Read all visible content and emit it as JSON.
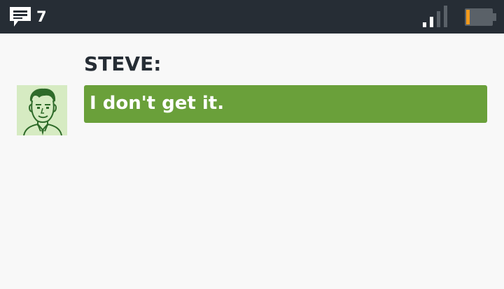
{
  "status_bar": {
    "message_icon": "message-icon",
    "message_count": "7",
    "signal_icon": "signal-icon",
    "battery_icon": "battery-icon",
    "signal_bars_active": 2,
    "signal_bars_total": 4,
    "battery_level": 0.15,
    "colors": {
      "background": "#262d35",
      "signal_active": "#ffffff",
      "signal_inactive": "#5a6168",
      "battery_body": "#5a6168",
      "battery_charge": "#f29a1c"
    }
  },
  "dialogue": {
    "speaker": "STEVE:",
    "avatar_icon": "steve-portrait-icon",
    "text": "I don't get it.",
    "colors": {
      "bubble": "#6aa03a",
      "avatar_bg": "#d6ebc2",
      "speaker_text": "#262d35"
    }
  }
}
